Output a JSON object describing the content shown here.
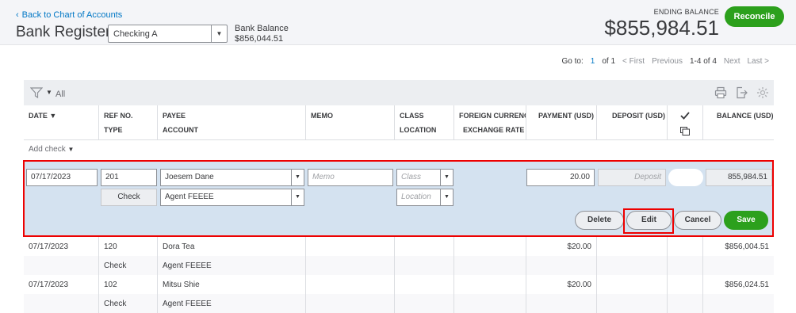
{
  "header": {
    "back_link": "Back to Chart of Accounts",
    "title": "Bank Register",
    "account_select": "Checking A",
    "bank_balance_label": "Bank Balance",
    "bank_balance_value": "$856,044.51",
    "ending_balance_label": "ENDING BALANCE",
    "ending_balance_value": "$855,984.51",
    "reconcile_label": "Reconcile"
  },
  "pager": {
    "goto_label": "Go to:",
    "page": "1",
    "of_label": "of 1",
    "first": "< First",
    "previous": "Previous",
    "range": "1-4 of 4",
    "next": "Next",
    "last": "Last >"
  },
  "toolbar": {
    "filter_label": "All",
    "icons": [
      "filter-icon",
      "print-icon",
      "export-icon",
      "settings-gear-icon"
    ]
  },
  "columns": {
    "date": "DATE",
    "ref_no": "REF NO.",
    "type": "TYPE",
    "payee": "PAYEE",
    "account": "ACCOUNT",
    "memo": "MEMO",
    "class": "CLASS",
    "location": "LOCATION",
    "foreign_currency": "FOREIGN CURRENC",
    "exchange_rate": "EXCHANGE RATE",
    "payment": "PAYMENT (USD)",
    "deposit": "DEPOSIT (USD)",
    "balance": "BALANCE (USD)"
  },
  "add_check_label": "Add check",
  "edit_row": {
    "date": "07/17/2023",
    "ref_no": "201",
    "payee": "Joesem Dane",
    "memo_placeholder": "Memo",
    "class_placeholder": "Class",
    "payment": "20.00",
    "deposit_placeholder": "Deposit",
    "balance": "855,984.51",
    "type": "Check",
    "account": "Agent FEEEE",
    "location_placeholder": "Location",
    "buttons": {
      "delete": "Delete",
      "edit": "Edit",
      "cancel": "Cancel",
      "save": "Save"
    }
  },
  "rows": [
    {
      "date": "07/17/2023",
      "ref_no": "120",
      "type": "Check",
      "payee": "Dora Tea",
      "account": "Agent FEEEE",
      "payment": "$20.00",
      "balance": "$856,004.51"
    },
    {
      "date": "07/17/2023",
      "ref_no": "102",
      "type": "Check",
      "payee": "Mitsu Shie",
      "account": "Agent FEEEE",
      "payment": "$20.00",
      "balance": "$856,024.51"
    }
  ],
  "colors": {
    "accent_green": "#2ca01c",
    "link_blue": "#0077c5",
    "edit_row_bg": "#d4e2f0",
    "highlight_red": "#ee0000"
  }
}
